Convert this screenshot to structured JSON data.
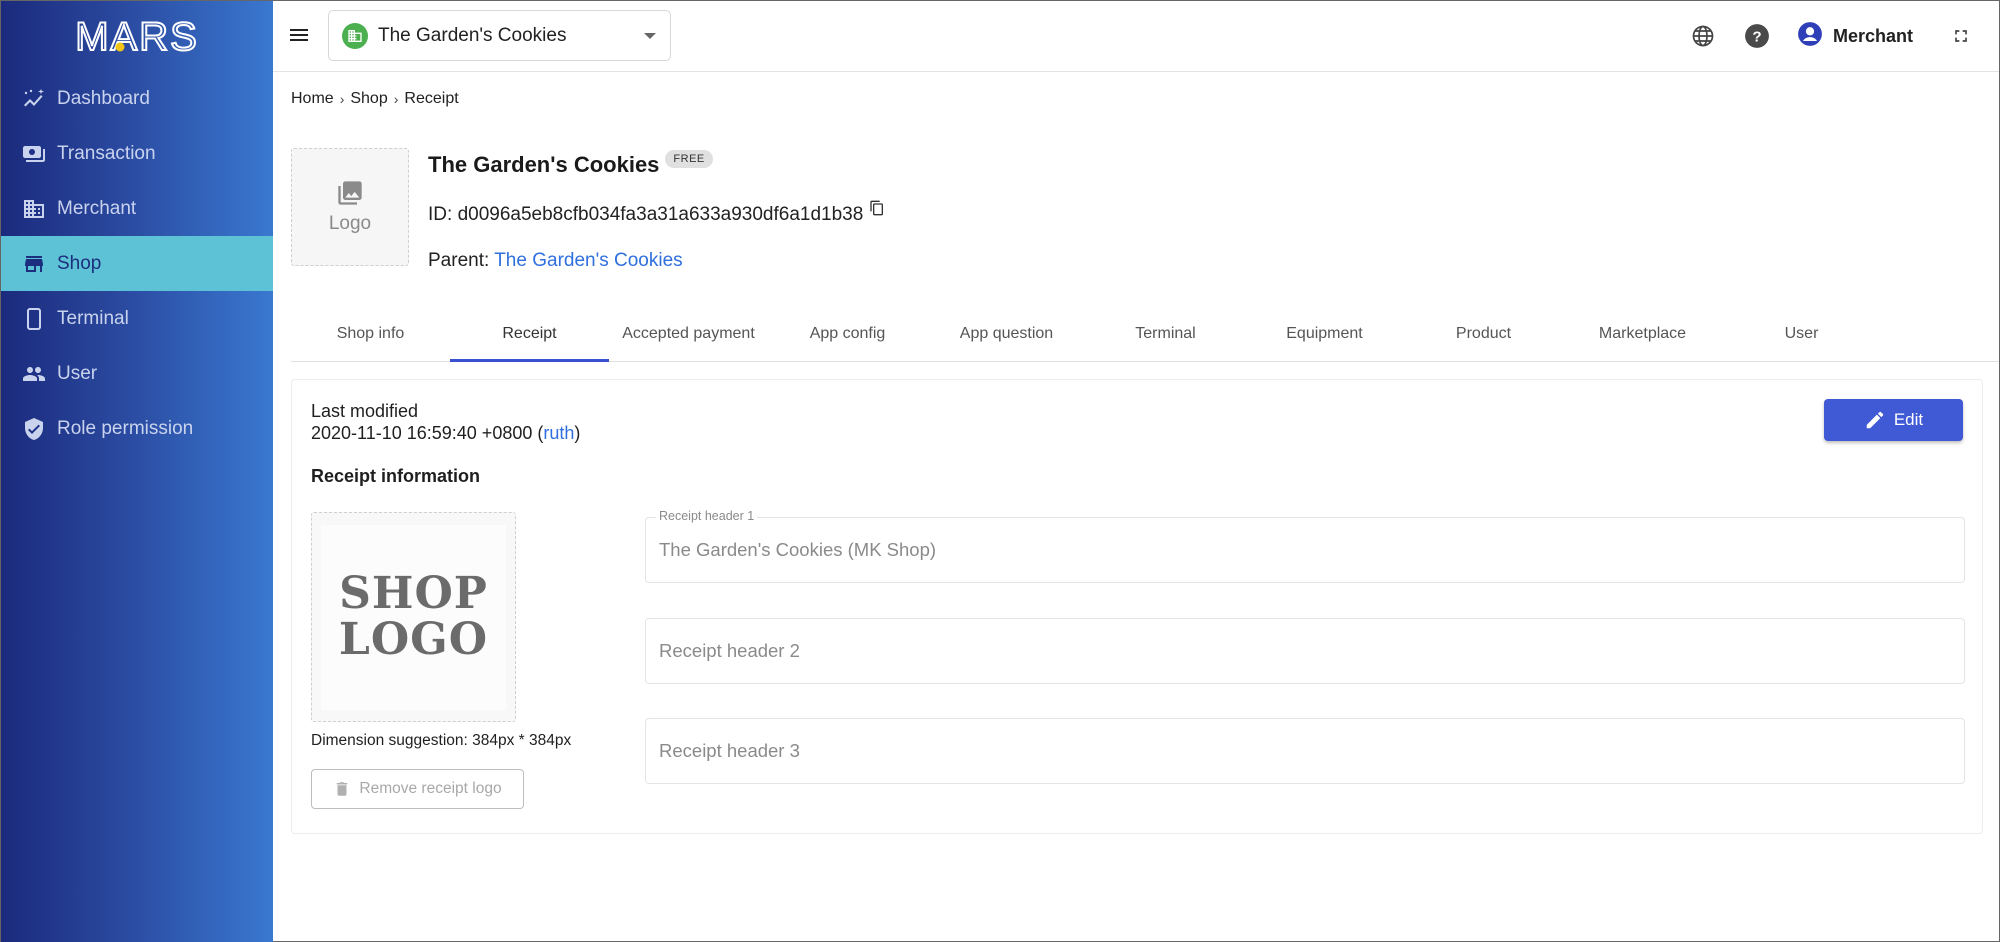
{
  "app": {
    "brand": "MARS"
  },
  "sidebar": {
    "items": [
      {
        "label": "Dashboard",
        "icon": "dashboard-icon",
        "active": false
      },
      {
        "label": "Transaction",
        "icon": "transaction-icon",
        "active": false
      },
      {
        "label": "Merchant",
        "icon": "merchant-icon",
        "active": false
      },
      {
        "label": "Shop",
        "icon": "shop-icon",
        "active": true
      },
      {
        "label": "Terminal",
        "icon": "terminal-icon",
        "active": false
      },
      {
        "label": "User",
        "icon": "user-icon",
        "active": false
      },
      {
        "label": "Role permission",
        "icon": "shield-icon",
        "active": false
      }
    ]
  },
  "topbar": {
    "shop_selector": {
      "value": "The Garden's Cookies"
    },
    "icons": [
      "menu-icon",
      "globe-icon",
      "help-icon",
      "account-icon",
      "fullscreen-icon"
    ],
    "user_label": "Merchant"
  },
  "breadcrumb": [
    "Home",
    "Shop",
    "Receipt"
  ],
  "shop": {
    "logo_placeholder": "Logo",
    "name": "The Garden's Cookies",
    "plan_badge": "FREE",
    "id_label": "ID:",
    "id": "d0096a5eb8cfb034fa3a31a633a930df6a1d1b38",
    "parent_label": "Parent:",
    "parent_name": "The Garden's Cookies"
  },
  "tabs": [
    {
      "label": "Shop info",
      "active": false
    },
    {
      "label": "Receipt",
      "active": true
    },
    {
      "label": "Accepted payment",
      "active": false
    },
    {
      "label": "App config",
      "active": false
    },
    {
      "label": "App question",
      "active": false
    },
    {
      "label": "Terminal",
      "active": false
    },
    {
      "label": "Equipment",
      "active": false
    },
    {
      "label": "Product",
      "active": false
    },
    {
      "label": "Marketplace",
      "active": false
    },
    {
      "label": "User",
      "active": false
    }
  ],
  "receipt": {
    "last_modified_label": "Last modified",
    "last_modified_time": "2020-11-10 16:59:40 +0800",
    "last_modified_by": "ruth",
    "edit_label": "Edit",
    "section_title": "Receipt information",
    "logo_text_line1": "SHOP",
    "logo_text_line2": "LOGO",
    "dimension_hint": "Dimension suggestion: 384px * 384px",
    "remove_logo_label": "Remove receipt logo",
    "fields": [
      {
        "label": "Receipt header 1",
        "value": "The Garden's Cookies (MK Shop)",
        "placeholder": ""
      },
      {
        "label": "",
        "value": "",
        "placeholder": "Receipt header 2"
      },
      {
        "label": "",
        "value": "",
        "placeholder": "Receipt header 3"
      }
    ]
  },
  "colors": {
    "sidebar_gradient_start": "#1b2a7c",
    "sidebar_gradient_end": "#3a78d0",
    "sidebar_active": "#5ec2d6",
    "primary": "#4059d4",
    "link": "#2f6fde",
    "shop_badge": "#4caf50"
  }
}
